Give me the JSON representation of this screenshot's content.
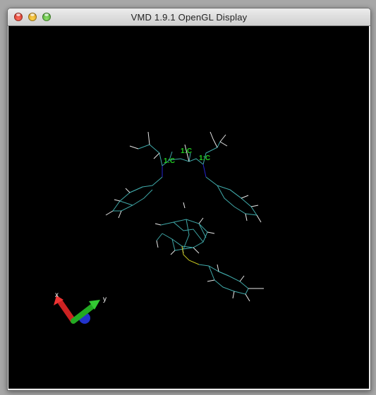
{
  "window": {
    "title": "VMD 1.9.1 OpenGL Display",
    "buttons": [
      "close",
      "minimize",
      "zoom"
    ]
  },
  "scene": {
    "background": "#000000",
    "atom_labels": [
      "1:C",
      "1:C",
      "1:C"
    ],
    "axes": {
      "x_label": "x",
      "y_label": "y"
    },
    "colors": {
      "bond_carbon": "#3fa8a8",
      "bond_hydrogen": "#e8e8e8",
      "bond_nitrogen": "#2323d0",
      "bond_sulfur": "#c8c820",
      "label": "#22cc22",
      "axis_x": "#cc2222",
      "axis_y": "#22aa22",
      "axis_z": "#2233cc"
    }
  }
}
